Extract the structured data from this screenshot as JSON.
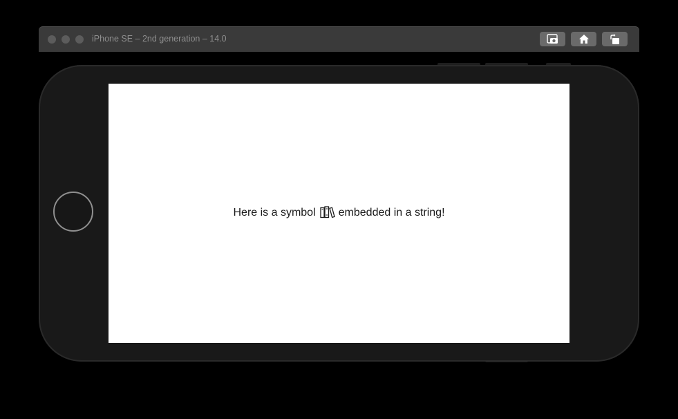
{
  "window": {
    "title": "iPhone SE – 2nd generation – 14.0"
  },
  "toolbar": {
    "buttons": [
      {
        "icon": "screenshot-camera-icon"
      },
      {
        "icon": "home-icon"
      },
      {
        "icon": "rotate-icon"
      }
    ]
  },
  "screen": {
    "text_before": "Here is a symbol",
    "symbol_icon": "books-vertical-icon",
    "text_after": "embedded in a string!"
  },
  "colors": {
    "background": "#000000",
    "titlebar": "#3a3a3a",
    "device_body": "#191919",
    "screen": "#ffffff",
    "text": "#1a1a1a"
  }
}
